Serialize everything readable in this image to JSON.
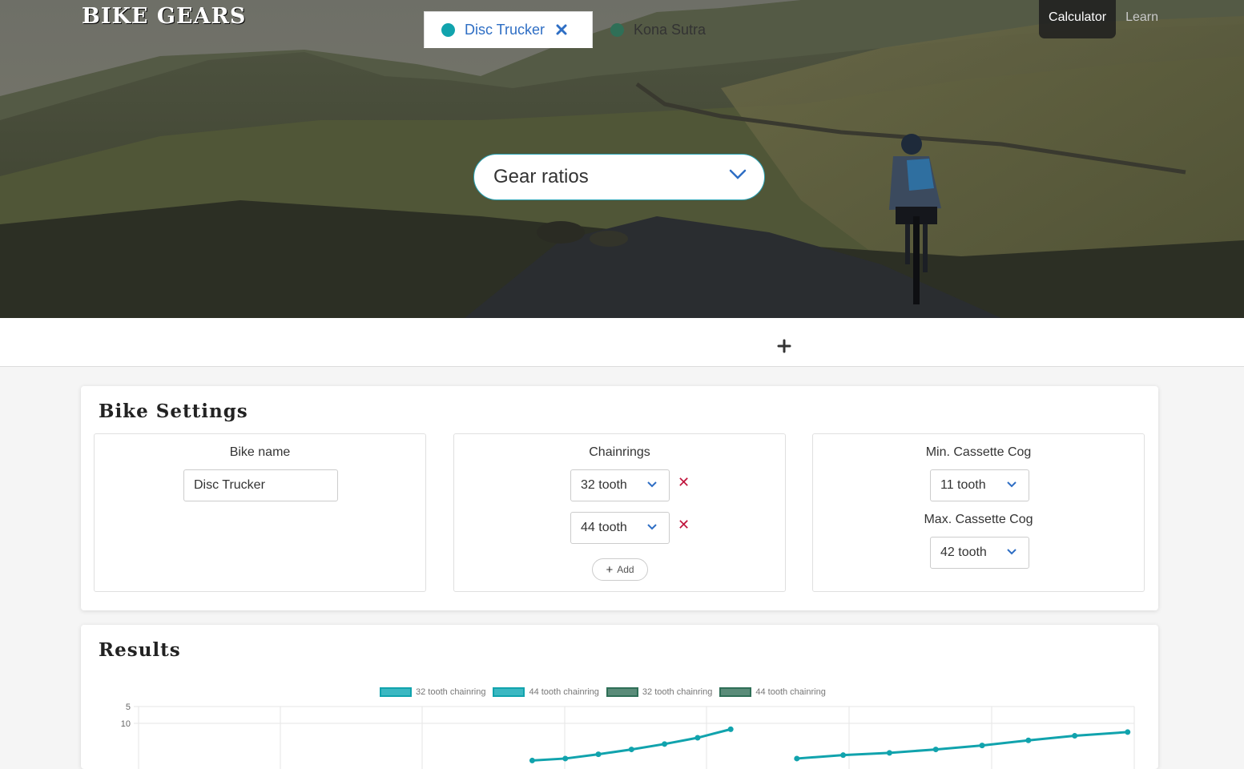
{
  "header": {
    "logo": "BIKE GEARS",
    "nav": [
      {
        "label": "Calculator",
        "active": true
      },
      {
        "label": "Learn",
        "active": false
      }
    ],
    "calculator_select": {
      "value": "Gear ratios"
    }
  },
  "tabs": [
    {
      "label": "Disc Trucker",
      "color": "#11a3ad",
      "active": true
    },
    {
      "label": "Kona Sutra",
      "color": "#2f6f57",
      "active": false
    }
  ],
  "bike_settings": {
    "title": "Bike Settings",
    "bike_name": {
      "label": "Bike name",
      "value": "Disc Trucker"
    },
    "chainrings": {
      "label": "Chainrings",
      "items": [
        "32 tooth",
        "44 tooth"
      ],
      "add_label": "Add"
    },
    "min_cog": {
      "label": "Min. Cassette Cog",
      "value": "11 tooth"
    },
    "max_cog": {
      "label": "Max. Cassette Cog",
      "value": "42 tooth"
    }
  },
  "results": {
    "title": "Results"
  },
  "chart_data": {
    "type": "line",
    "legend": [
      {
        "name": "32 tooth chainring",
        "color": "#11a3ad"
      },
      {
        "name": "44 tooth chainring",
        "color": "#11a3ad"
      },
      {
        "name": "32 tooth chainring",
        "color": "#2f6f57"
      },
      {
        "name": "44 tooth chainring",
        "color": "#2f6f57"
      }
    ],
    "y_tick_labels": [
      "5",
      "10"
    ],
    "grid": true,
    "legend_position": "top",
    "series": [
      {
        "name": "32 tooth chainring",
        "color": "#11a3ad",
        "x": [
          7,
          7.5,
          8,
          8.5,
          9,
          9.5,
          10
        ],
        "y": [
          23.5,
          22.8,
          21.3,
          19.6,
          17.7,
          15.5,
          12.5
        ]
      },
      {
        "name": "32 tooth chainring",
        "color": "#11a3ad",
        "x": [
          11,
          11.7,
          12.4,
          13.1,
          13.8,
          14.5,
          15.2,
          16
        ],
        "y": [
          22.8,
          21.6,
          20.8,
          19.6,
          18.2,
          16.4,
          14.8,
          13.5
        ]
      }
    ]
  }
}
